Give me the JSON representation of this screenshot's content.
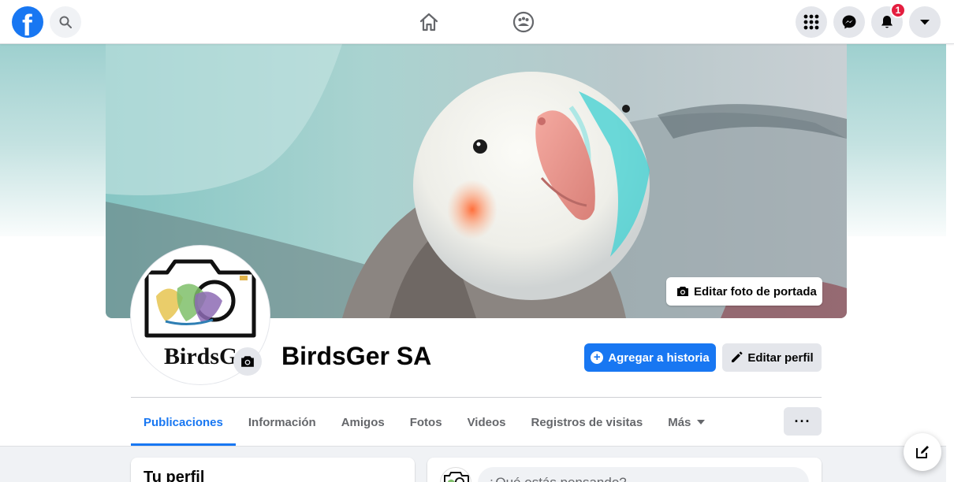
{
  "topbar": {
    "logo_letter": "f",
    "icons": {
      "logo": "facebook-logo-icon",
      "search": "search-icon",
      "home": "home-icon",
      "groups": "groups-icon",
      "menu": "grid-menu-icon",
      "messenger": "messenger-icon",
      "notifications": "bell-icon",
      "account": "caret-down-icon"
    },
    "notification_count": "1"
  },
  "cover": {
    "edit_button_label": "Editar foto de portada",
    "edit_icon": "camera-icon"
  },
  "profile": {
    "name": "BirdsGer SA",
    "avatar_logo_text": "BirdsGer",
    "avatar_camera_icon": "camera-icon"
  },
  "actions": {
    "add_story_label": "Agregar a historia",
    "edit_profile_label": "Editar perfil"
  },
  "tabs": [
    {
      "label": "Publicaciones",
      "active": true
    },
    {
      "label": "Información",
      "active": false
    },
    {
      "label": "Amigos",
      "active": false
    },
    {
      "label": "Fotos",
      "active": false
    },
    {
      "label": "Videos",
      "active": false
    },
    {
      "label": "Registros de visitas",
      "active": false
    },
    {
      "label": "Más",
      "active": false
    }
  ],
  "more_button_label": "···",
  "intro_card": {
    "title": "Tu perfil"
  },
  "composer": {
    "placeholder": "¿Qué estás pensando?"
  },
  "colors": {
    "brand": "#1877f2",
    "badge": "#e41e3f",
    "secondary_button": "#e4e6eb",
    "page_bg": "#f0f2f5"
  }
}
